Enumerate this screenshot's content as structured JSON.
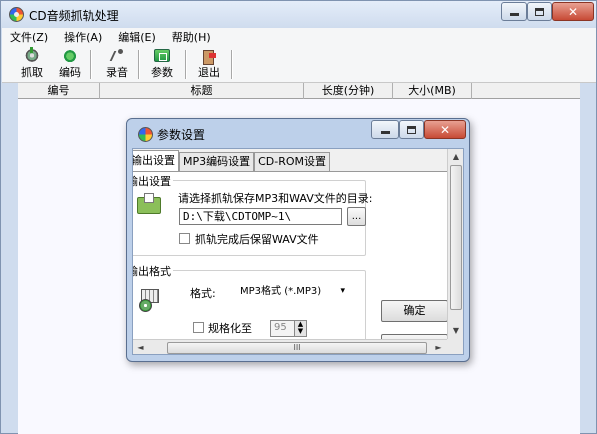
{
  "app": {
    "title": "CD音频抓轨处理"
  },
  "menu": [
    "文件(Z)",
    "操作(A)",
    "编辑(E)",
    "帮助(H)"
  ],
  "toolbar": {
    "grab": "抓取",
    "encode": "编码",
    "record": "录音",
    "params": "参数",
    "exit": "退出"
  },
  "list": {
    "columns": [
      "编号",
      "标题",
      "长度(分钟)",
      "大小(MB)"
    ]
  },
  "dialog": {
    "title": "参数设置",
    "tabs": [
      "输出设置",
      "MP3编码设置",
      "CD-ROM设置"
    ],
    "output_group": {
      "label": "输出设置",
      "prompt": "请选择抓轨保存MP3和WAV文件的目录:",
      "path": "D:\\下载\\CDTOMP~1\\",
      "browse": "...",
      "keep_wav_label": "抓轨完成后保留WAV文件",
      "keep_wav_checked": false
    },
    "format_group": {
      "label": "输出格式",
      "format_label": "格式:",
      "format_value": "MP3格式 (*.MP3)",
      "normalize_label": "规格化至",
      "normalize_checked": false,
      "normalize_value": "95"
    },
    "ok": "确定",
    "hscroll_grip": "III"
  },
  "icons": {
    "close": "✕",
    "arrow_down": "▼",
    "arrow_up": "▲",
    "arrow_left": "◄",
    "arrow_right": "►",
    "select_arrow": "▾"
  }
}
